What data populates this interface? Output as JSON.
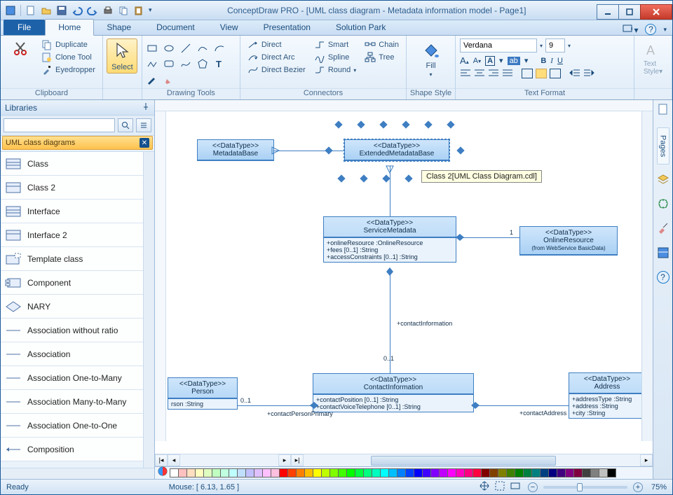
{
  "title": "ConceptDraw PRO - [UML class diagram - Metadata information model - Page1]",
  "tabs": {
    "file": "File",
    "home": "Home",
    "shape": "Shape",
    "document": "Document",
    "view": "View",
    "presentation": "Presentation",
    "solution": "Solution Park"
  },
  "ribbon": {
    "clipboard": {
      "label": "Clipboard",
      "duplicate": "Duplicate",
      "clone": "Clone Tool",
      "eyedropper": "Eyedropper"
    },
    "select": {
      "label": "Select"
    },
    "drawing": {
      "label": "Drawing Tools"
    },
    "connectors": {
      "label": "Connectors",
      "direct": "Direct",
      "directarc": "Direct Arc",
      "directbezier": "Direct Bezier",
      "smart": "Smart",
      "spline": "Spline",
      "round": "Round",
      "chain": "Chain",
      "tree": "Tree"
    },
    "shapestyle": {
      "label": "Shape Style",
      "fill": "Fill"
    },
    "textformat": {
      "label": "Text Format",
      "font": "Verdana",
      "size": "9"
    },
    "textstyle": {
      "label": "Text Style"
    }
  },
  "sidebar": {
    "title": "Libraries",
    "libname": "UML class diagrams",
    "items": [
      "Class",
      "Class 2",
      "Interface",
      "Interface 2",
      "Template class",
      "Component",
      "NARY",
      "Association without ratio",
      "Association",
      "Association One-to-Many",
      "Association Many-to-Many",
      "Association One-to-One",
      "Composition"
    ]
  },
  "canvas": {
    "box1": {
      "stereo": "<<DataType>>",
      "name": "MetadataBase"
    },
    "box2": {
      "stereo": "<<DataType>>",
      "name": "ExtendedMetadataBase"
    },
    "box3": {
      "stereo": "<<DataType>>",
      "name": "ServiceMetadata",
      "a1": "+onlineResource :OnlineResource",
      "a2": "+fees [0..1] :String",
      "a3": "+accessConstraints [0..1] :String"
    },
    "box4": {
      "stereo": "<<DataType>>",
      "name": "OnlineResource",
      "sub": "(from WebService BasicData)"
    },
    "box5": {
      "stereo": "<<DataType>>",
      "name": "ContactInformation",
      "a1": "+contactPosition [0..1] :String",
      "a2": "+contactVoiceTelephone [0..1] :String"
    },
    "box6": {
      "stereo": "<<DataType>>",
      "name": "Person",
      "a1": "rson :String"
    },
    "box7": {
      "stereo": "<<DataType>>",
      "name": "Address",
      "a1": "+addressType :String",
      "a2": "+address :String",
      "a3": "+city :String"
    },
    "lbl_contactInfo": "+contactInformation",
    "lbl_01a": "0..1",
    "lbl_01b": "0..1",
    "lbl_1": "1",
    "lbl_personPrimary": "+contactPersonPrimary",
    "lbl_contactAddress": "+contactAddress",
    "tooltip": "Class 2[UML Class Diagram.cdl]"
  },
  "rightdock": {
    "pages": "Pages"
  },
  "status": {
    "ready": "Ready",
    "mouse": "Mouse: [ 6.13, 1.65 ]",
    "zoom": "75%"
  },
  "palette": [
    "#ffffff",
    "#ffc0c0",
    "#ffdfc0",
    "#ffffc0",
    "#dfffc0",
    "#c0ffc0",
    "#c0ffdf",
    "#c0ffff",
    "#c0dfff",
    "#c0c0ff",
    "#dfc0ff",
    "#ffc0ff",
    "#ffc0df",
    "#ff0000",
    "#ff4000",
    "#ff8000",
    "#ffbf00",
    "#ffff00",
    "#bfff00",
    "#80ff00",
    "#40ff00",
    "#00ff00",
    "#00ff40",
    "#00ff80",
    "#00ffbf",
    "#00ffff",
    "#00bfff",
    "#0080ff",
    "#0040ff",
    "#0000ff",
    "#4000ff",
    "#8000ff",
    "#bf00ff",
    "#ff00ff",
    "#ff00bf",
    "#ff0080",
    "#ff0040",
    "#800000",
    "#804000",
    "#808000",
    "#408000",
    "#008000",
    "#008040",
    "#008080",
    "#004080",
    "#000080",
    "#400080",
    "#800080",
    "#800040",
    "#404040",
    "#808080",
    "#c0c0c0",
    "#000000"
  ]
}
